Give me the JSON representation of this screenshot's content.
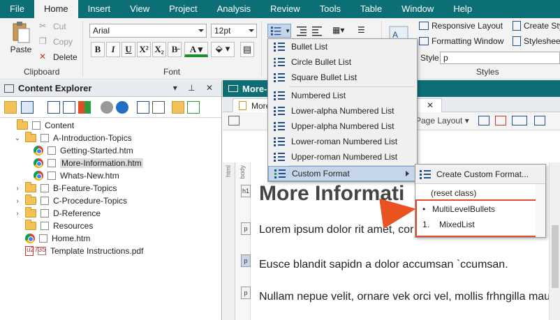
{
  "menubar": {
    "items": [
      "File",
      "Home",
      "Insert",
      "View",
      "Project",
      "Analysis",
      "Review",
      "Tools",
      "Table",
      "Window",
      "Help"
    ]
  },
  "ribbon": {
    "clipboard": {
      "paste": "Paste",
      "cut": "Cut",
      "copy": "Copy",
      "delete": "Delete",
      "label": "Clipboard"
    },
    "font": {
      "family": "Arial",
      "size": "12pt",
      "label": "Font"
    },
    "styles": {
      "responsive_layout": "Responsive Layout",
      "formatting_window": "Formatting Window",
      "create_style": "Create Sty",
      "stylesheet": "Styleshee",
      "style_label": "Style",
      "style_value": "p",
      "label": "Styles"
    }
  },
  "content_explorer": {
    "title": "Content Explorer",
    "tree": [
      {
        "label": "Content",
        "type": "folder"
      },
      {
        "label": "A-Introduction-Topics",
        "type": "folder"
      },
      {
        "label": "Getting-Started.htm",
        "type": "file"
      },
      {
        "label": "More-Information.htm",
        "type": "file"
      },
      {
        "label": "Whats-New.htm",
        "type": "file"
      },
      {
        "label": "B-Feature-Topics",
        "type": "folder"
      },
      {
        "label": "C-Procedure-Topics",
        "type": "folder"
      },
      {
        "label": "D-Reference",
        "type": "folder"
      },
      {
        "label": "Resources",
        "type": "folder"
      },
      {
        "label": "Home.htm",
        "type": "file"
      },
      {
        "label": "Template Instructions.pdf",
        "type": "pdf"
      }
    ]
  },
  "editor": {
    "title": "More-I",
    "tab_label": "More",
    "toolbar_page_layout": "Page Layout",
    "heading": "More Informati",
    "paragraphs": [
      "Lorem ipsum dolor rit amet, cor",
      "Eusce blandit sapidn a dolor accumsan `ccumsan.",
      "Nullam nepue velit, ornare vek orci vel, mollis frhngilla mau"
    ],
    "tags": {
      "html": "html",
      "body": "body",
      "h1": "h1",
      "p": "p"
    }
  },
  "list_menu": {
    "items": [
      "Bullet List",
      "Circle Bullet List",
      "Square Bullet List",
      "Numbered List",
      "Lower-alpha Numbered List",
      "Upper-alpha Numbered List",
      "Lower-roman Numbered List",
      "Upper-roman Numbered List",
      "Custom Format"
    ]
  },
  "submenu": {
    "create": "Create Custom Format...",
    "reset": "(reset class)",
    "options": [
      {
        "marker": "•",
        "label": "MultiLevelBullets"
      },
      {
        "marker": "1.",
        "label": "MixedList"
      }
    ]
  },
  "colors": {
    "accent": "#0c6f75",
    "highlight_box": "#e34c26",
    "menu_hover": "#c5d6ea"
  }
}
